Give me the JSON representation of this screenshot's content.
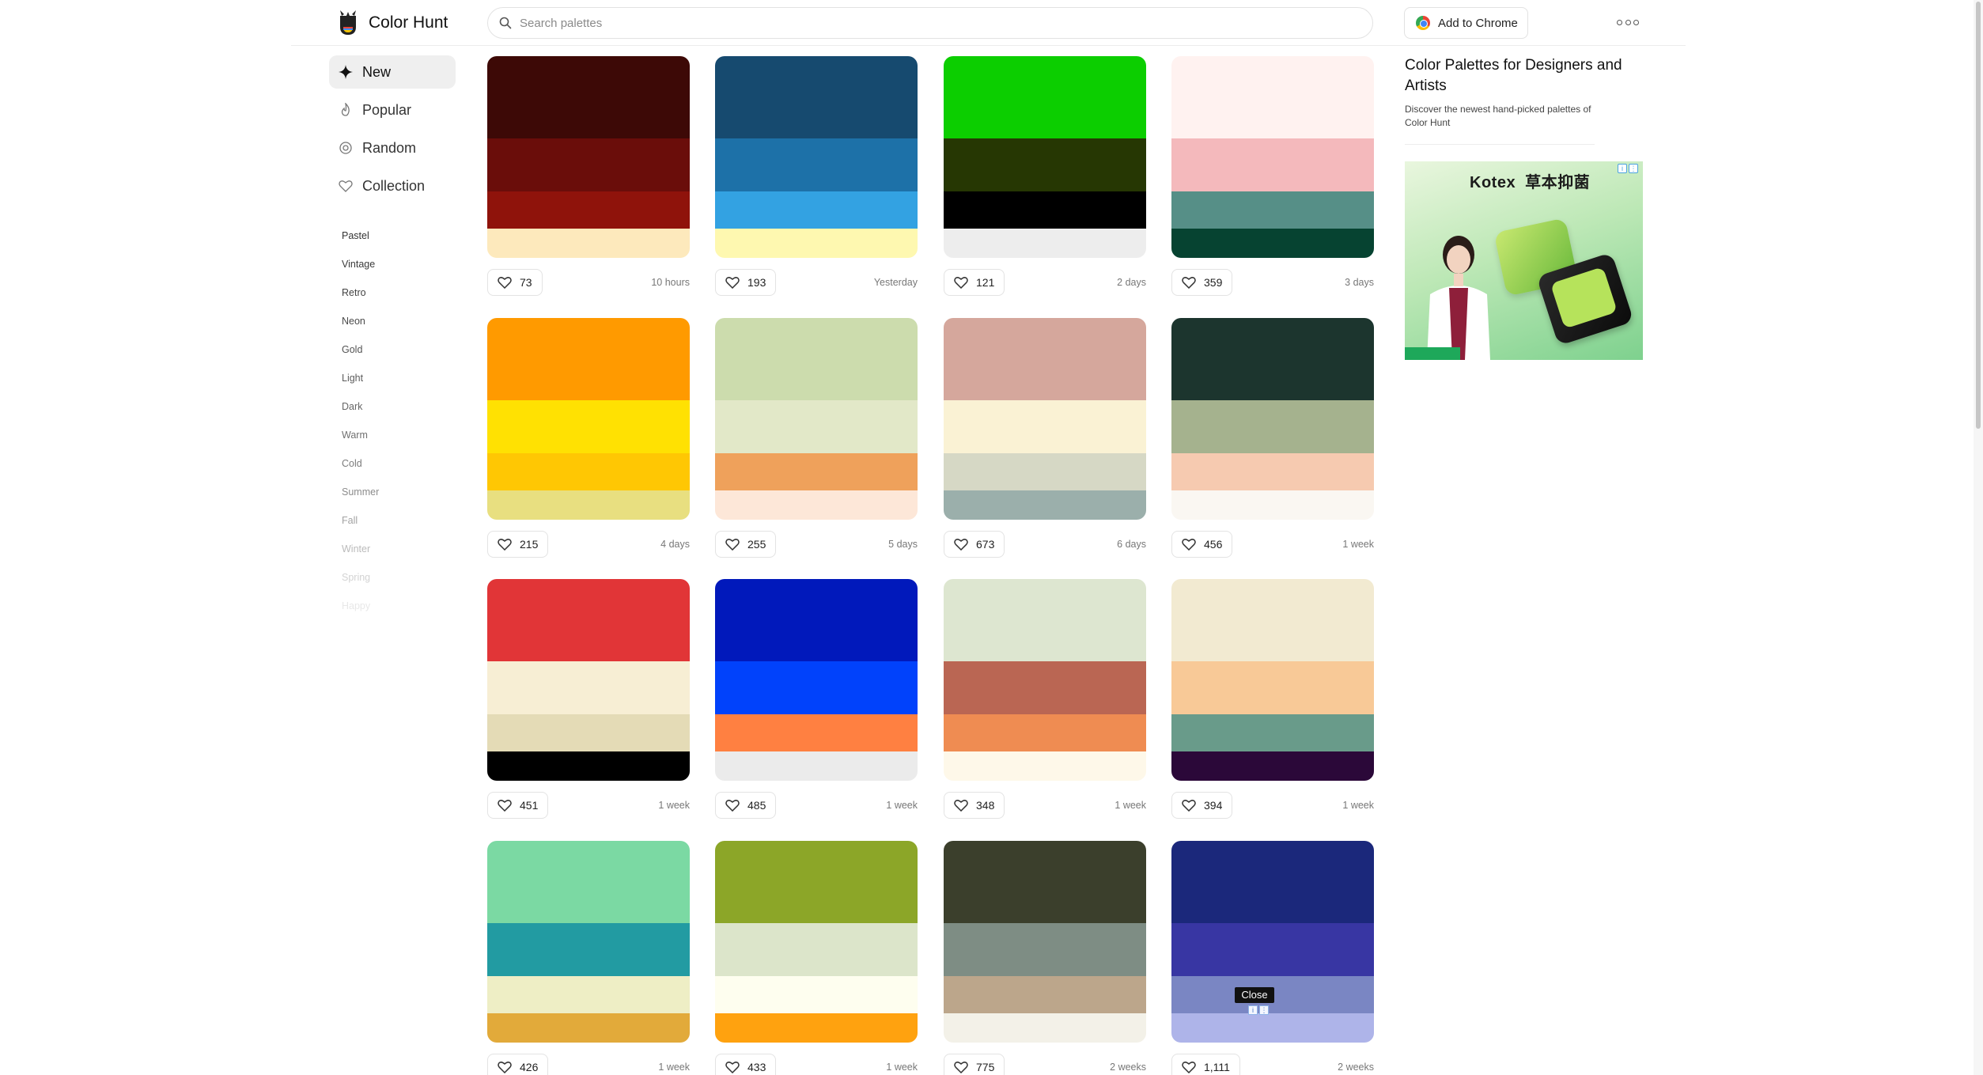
{
  "header": {
    "logo_text": "Color Hunt",
    "search_placeholder": "Search palettes",
    "chrome_button": "Add to Chrome"
  },
  "sidebar": {
    "nav": [
      {
        "label": "New",
        "icon": "sparkle-icon",
        "active": true
      },
      {
        "label": "Popular",
        "icon": "flame-icon"
      },
      {
        "label": "Random",
        "icon": "random-icon"
      },
      {
        "label": "Collection",
        "icon": "heart-icon"
      }
    ],
    "tags": [
      "Pastel",
      "Vintage",
      "Retro",
      "Neon",
      "Gold",
      "Light",
      "Dark",
      "Warm",
      "Cold",
      "Summer",
      "Fall",
      "Winter",
      "Spring",
      "Happy"
    ]
  },
  "palettes": [
    {
      "colors": [
        "#3d0906",
        "#6a0d0a",
        "#8f130b",
        "#fde9bc"
      ],
      "likes": "73",
      "time": "10 hours"
    },
    {
      "colors": [
        "#164a6f",
        "#1d71a8",
        "#33a2e2",
        "#fef8b0"
      ],
      "likes": "193",
      "time": "Yesterday"
    },
    {
      "colors": [
        "#0cce00",
        "#263703",
        "#000000",
        "#ededed"
      ],
      "likes": "121",
      "time": "2 days"
    },
    {
      "colors": [
        "#fff2f0",
        "#f4b9bc",
        "#568f87",
        "#064331"
      ],
      "likes": "359",
      "time": "3 days"
    },
    {
      "colors": [
        "#ff9a00",
        "#ffe102",
        "#ffc703",
        "#e8df80"
      ],
      "likes": "215",
      "time": "4 days"
    },
    {
      "colors": [
        "#ccdcad",
        "#e2e8c8",
        "#efa15b",
        "#fde7d8"
      ],
      "likes": "255",
      "time": "5 days"
    },
    {
      "colors": [
        "#d5a79c",
        "#faf2d4",
        "#d6d8c5",
        "#9bafab"
      ],
      "likes": "673",
      "time": "6 days"
    },
    {
      "colors": [
        "#1c352e",
        "#a5b28e",
        "#f6cab0",
        "#faf7f2"
      ],
      "likes": "456",
      "time": "1 week"
    },
    {
      "colors": [
        "#e13537",
        "#f7eed4",
        "#e4dbb6",
        "#000000"
      ],
      "likes": "451",
      "time": "1 week"
    },
    {
      "colors": [
        "#0119bb",
        "#0142fb",
        "#ff8041",
        "#ebebeb"
      ],
      "likes": "485",
      "time": "1 week"
    },
    {
      "colors": [
        "#dde6d0",
        "#ba6653",
        "#ef8c52",
        "#fef8e9"
      ],
      "likes": "348",
      "time": "1 week"
    },
    {
      "colors": [
        "#f2ead1",
        "#f8c997",
        "#699b8a",
        "#2b0839"
      ],
      "likes": "394",
      "time": "1 week"
    },
    {
      "colors": [
        "#7bd9a3",
        "#229ba2",
        "#eeeec5",
        "#e2aa3a"
      ],
      "likes": "426",
      "time": "1 week"
    },
    {
      "colors": [
        "#8ca628",
        "#dce5ca",
        "#fefeef",
        "#ffa20f"
      ],
      "likes": "433",
      "time": "1 week"
    },
    {
      "colors": [
        "#3b3f2c",
        "#7e8d84",
        "#bca68b",
        "#f3f1e8"
      ],
      "likes": "775",
      "time": "2 weeks"
    },
    {
      "colors": [
        "#1b287b",
        "#3836a3",
        "#7a86c3",
        "#aeb4e9"
      ],
      "likes": "1,111",
      "time": "2 weeks"
    }
  ],
  "aside": {
    "title": "Color Palettes for Designers and Artists",
    "description": "Discover the newest hand-picked palettes of Color Hunt"
  },
  "ad": {
    "brand": "Kotex",
    "tagline": "草本抑菌"
  },
  "overlay": {
    "close_label": "Close"
  }
}
